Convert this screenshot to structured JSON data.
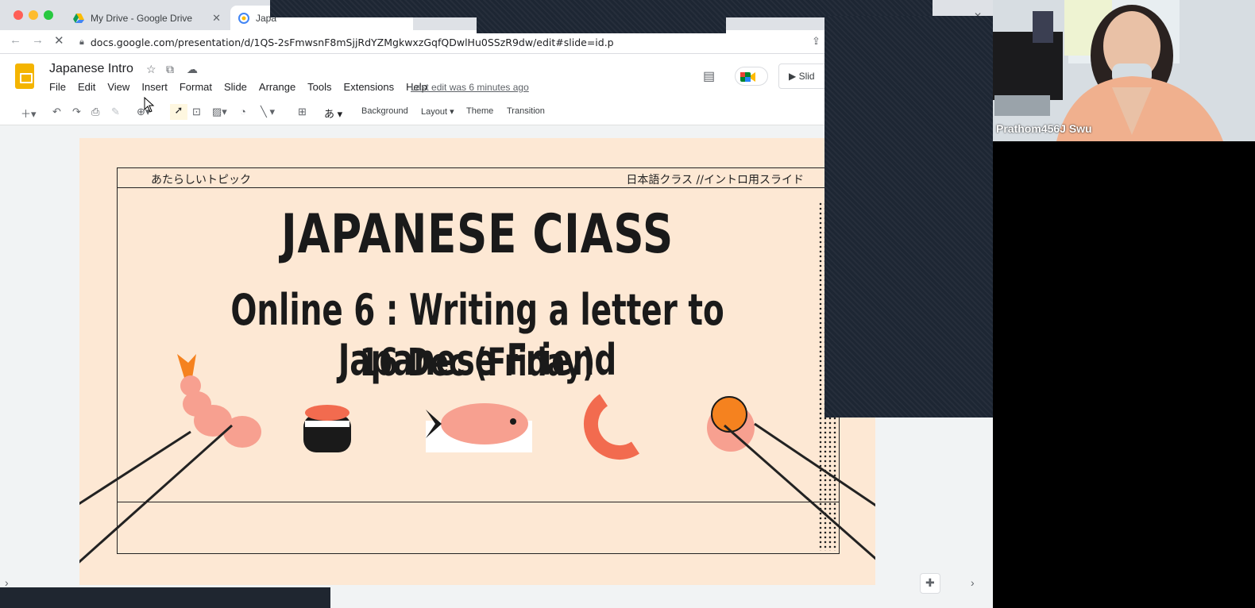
{
  "browser": {
    "tabs": [
      {
        "label": "My Drive - Google Drive",
        "active": false
      },
      {
        "label": "Japa",
        "active": true
      }
    ],
    "url": "docs.google.com/presentation/d/1QS-2sFmwsnF8mSjjRdYZMgkwxzGqfQDwlHu0SSzR9dw/edit#slide=id.p"
  },
  "slides_app": {
    "doc_title": "Japanese Intro",
    "menu": [
      "File",
      "Edit",
      "View",
      "Insert",
      "Format",
      "Slide",
      "Arrange",
      "Tools",
      "Extensions",
      "Help"
    ],
    "last_edit": "Last edit was 6 minutes ago",
    "slideshow_label": "Slid",
    "toolbar": {
      "background": "Background",
      "layout": "Layout",
      "theme": "Theme",
      "transition": "Transition",
      "input_tool": "あ"
    }
  },
  "slide": {
    "topic_left": "あたらしいトピック",
    "topic_right": "日本語クラス //イントロ用スライド",
    "title": "JAPANESE CIASS",
    "subtitle": "Online 6 : Writing a letter to Japanese Friend",
    "date": "16 Dec (Friday)"
  },
  "video": {
    "participant_name": "Prathom456J Swu"
  },
  "colors": {
    "slide_bg": "#fde8d4",
    "overlay_dark": "#1d2633",
    "shrimp": "#f7a090",
    "orange": "#f5821f"
  }
}
